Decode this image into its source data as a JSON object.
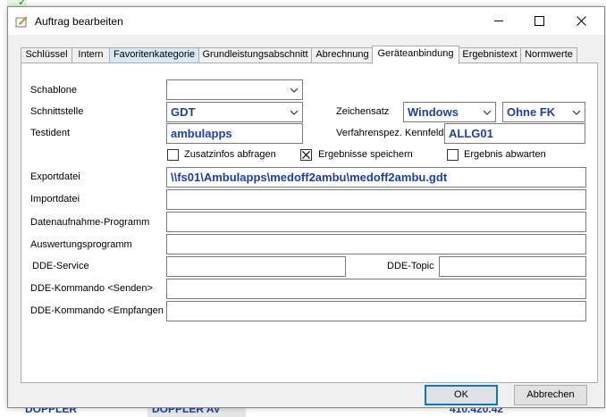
{
  "background": {
    "row": [
      "DOPPLER",
      "DOPPLER AV",
      "410.420.42"
    ]
  },
  "window": {
    "title": "Auftrag bearbeiten",
    "minimize_icon": "minimize-icon",
    "maximize_icon": "maximize-icon",
    "close_icon": "close-icon"
  },
  "tabs": [
    {
      "label": "Schlüssel"
    },
    {
      "label": "Intern"
    },
    {
      "label": "Favoritenkategorie"
    },
    {
      "label": "Grundleistungsabschnitt"
    },
    {
      "label": "Abrechnung"
    },
    {
      "label": "Geräteanbindung"
    },
    {
      "label": "Ergebnistext"
    },
    {
      "label": "Normwerte"
    }
  ],
  "active_tab": "Geräteanbindung",
  "form": {
    "schablone": {
      "label": "Schablone",
      "value": ""
    },
    "schnittstelle": {
      "label": "Schnittstelle",
      "value": "GDT"
    },
    "zeichensatz": {
      "label": "Zeichensatz",
      "value": "Windows",
      "option2": "Ohne FK"
    },
    "testident": {
      "label": "Testident",
      "value": "ambulapps"
    },
    "kennfeld": {
      "label": "Verfahrenspez. Kennfeld",
      "value": "ALLG01"
    },
    "zusatzinfos": {
      "label": "Zusatzinfos abfragen",
      "checked": false
    },
    "ergebnisse_speichern": {
      "label": "Ergebnisse speichern",
      "checked": true
    },
    "ergebnis_abwarten": {
      "label": "Ergebnis abwarten",
      "checked": false
    },
    "exportdatei": {
      "label": "Exportdatei",
      "value": "\\\\fs01\\Ambulapps\\medoff2ambu\\medoff2ambu.gdt"
    },
    "importdatei": {
      "label": "Importdatei",
      "value": ""
    },
    "datenaufnahme": {
      "label": "Datenaufnahme-Programm",
      "value": ""
    },
    "auswertung": {
      "label": "Auswertungsprogramm",
      "value": ""
    },
    "dde_service": {
      "label": "DDE-Service",
      "value": ""
    },
    "dde_topic": {
      "label": "DDE-Topic",
      "value": ""
    },
    "dde_senden": {
      "label": "DDE-Kommando <Senden>",
      "value": ""
    },
    "dde_empfangen": {
      "label": "DDE-Kommando <Empfangen",
      "value": ""
    }
  },
  "buttons": {
    "ok": "OK",
    "cancel": "Abbrechen"
  },
  "colors": {
    "value_text": "#1e3ea8",
    "active_tab_highlight": "#d9e8f6",
    "default_button_border": "#0078d7"
  }
}
